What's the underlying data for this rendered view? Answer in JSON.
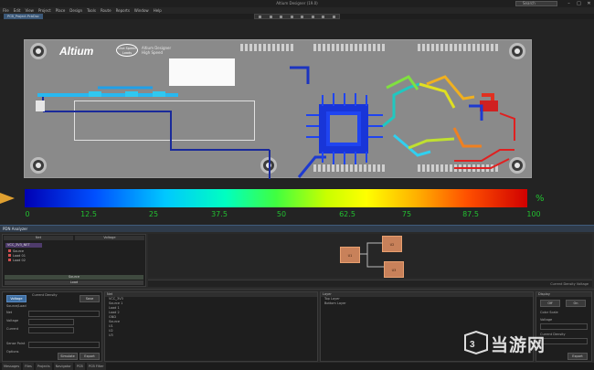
{
  "window": {
    "title": "Altium Designer (19.0)",
    "search_placeholder": "Search",
    "controls": [
      "–",
      "□",
      "✕"
    ]
  },
  "menu": [
    "File",
    "Edit",
    "View",
    "Project",
    "Place",
    "Design",
    "Tools",
    "Route",
    "Reports",
    "Window",
    "Help"
  ],
  "tabs": {
    "active": "PCB_Project.PcbDoc"
  },
  "board": {
    "logo": "Altium",
    "badge": "Live Speed Loads",
    "silkscreen": "Altium Designer\nHigh Speed"
  },
  "scale": {
    "unit": "%",
    "ticks": [
      "0",
      "12.5",
      "25",
      "37.5",
      "50",
      "62.5",
      "75",
      "87.5",
      "100"
    ],
    "colors": [
      "#0000b4",
      "#0050ff",
      "#00c8ff",
      "#00ffc0",
      "#40ff40",
      "#c8ff00",
      "#ffff00",
      "#ffb000",
      "#ff5000",
      "#d00000"
    ]
  },
  "panel_title": "PDN Analyzer",
  "nets_panel": {
    "col_headers": [
      "Net",
      "Voltage"
    ],
    "selected_net": "VCC_3V3_NET",
    "net_items": [
      "Source",
      "Load 01",
      "Load 02"
    ],
    "source_bar": "Source",
    "load_bar": "Load"
  },
  "graph": {
    "nodes": [
      "U1",
      "U2",
      "U3"
    ],
    "footer_left": "Source  Load  Via  Layer",
    "footer_right": "Current Density  Voltage"
  },
  "settings_panel": {
    "tabs": [
      "Voltage",
      "Current Density",
      "Save"
    ],
    "rows": [
      "Source/Load",
      "Net",
      "Voltage",
      "Current",
      "Sense Point",
      "Options"
    ],
    "buttons": [
      "Simulate",
      "Export"
    ]
  },
  "objects_panel": {
    "header": "Net",
    "items": [
      "VCC_3V3",
      "  Source 1",
      "  Load 1",
      "  Load 2",
      "GND",
      "  Source",
      "  U1",
      "  U2",
      "  U3"
    ]
  },
  "results_panel": {
    "header": "Layer",
    "items": [
      "Top Layer",
      "Bottom Layer"
    ]
  },
  "right_panel": {
    "header": "Display",
    "buttons": [
      "Off",
      "On"
    ],
    "labels": [
      "Color Scale",
      "Voltage",
      "Current Density"
    ],
    "export_label": "Export"
  },
  "status": [
    "Messages",
    "Files",
    "Projects",
    "Navigator",
    "PCB",
    "PCB Filter"
  ],
  "watermark": "当游网"
}
